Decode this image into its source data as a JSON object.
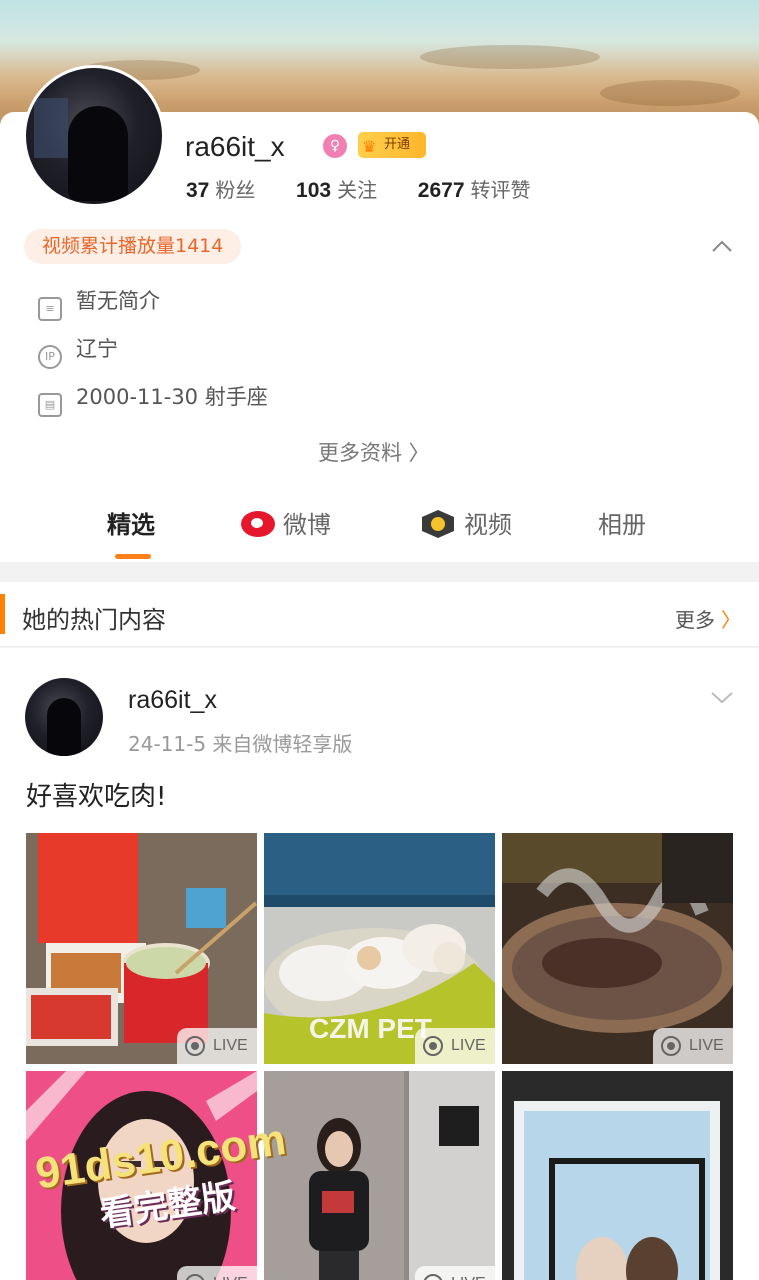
{
  "profile": {
    "username": "ra66it_x",
    "gender_icon": "female-icon",
    "vip_label": "开通",
    "stats": [
      {
        "num": "37",
        "label": "粉丝"
      },
      {
        "num": "103",
        "label": "关注"
      },
      {
        "num": "2677",
        "label": "转评赞"
      }
    ],
    "video_pill": "视频累计播放量1414",
    "info": {
      "bio": "暂无简介",
      "location": "辽宁",
      "birthday": "2000-11-30 射手座",
      "ip_icon_text": "IP"
    },
    "more_info": "更多资料 〉"
  },
  "tabs": [
    "精选",
    "微博",
    "视频",
    "相册"
  ],
  "hot_section": {
    "title": "她的热门内容",
    "more": "更多"
  },
  "post": {
    "username": "ra66it_x",
    "meta": "24-11-5  来自微博轻享版",
    "text": "好喜欢吃肉!",
    "live_label": "LIVE"
  },
  "watermark": {
    "line1": "91ds10.com",
    "line2": "看完整版"
  },
  "colors": {
    "accent": "#ff8200",
    "pill_text": "#e8672a",
    "weibo_red": "#e6162d"
  }
}
